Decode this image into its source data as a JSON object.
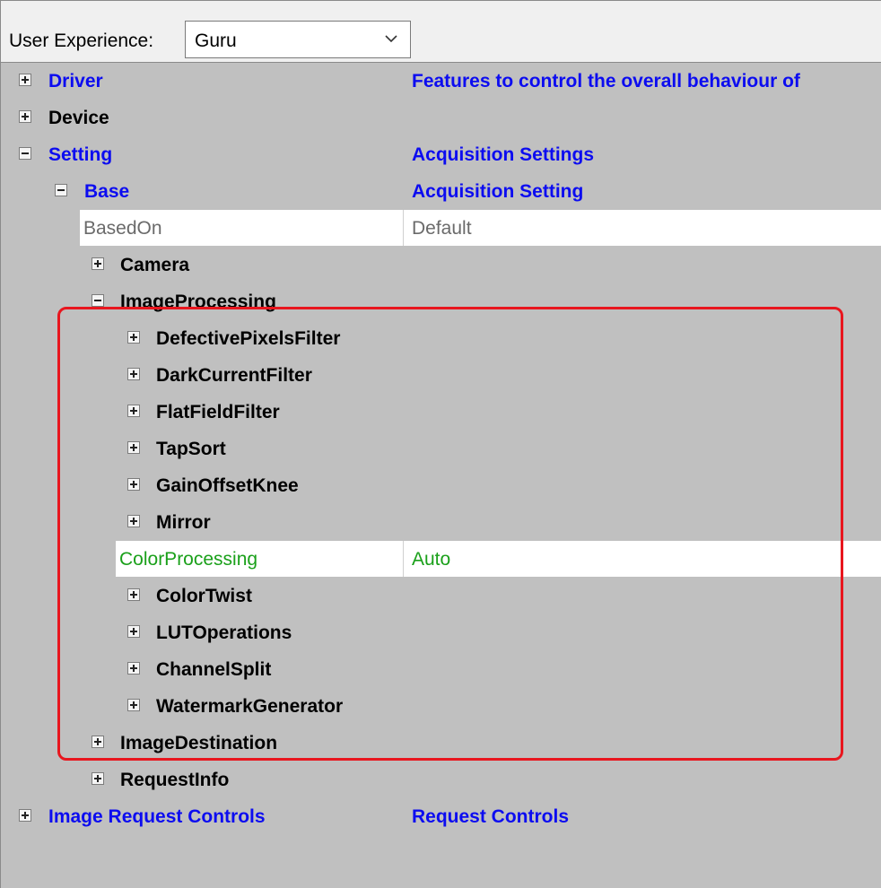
{
  "toolbar": {
    "ux_label": "User Experience:",
    "ux_value": "Guru"
  },
  "tree": {
    "driver": {
      "label": "Driver",
      "desc": "Features to control the overall behaviour of"
    },
    "device": {
      "label": "Device"
    },
    "setting": {
      "label": "Setting",
      "desc": "Acquisition Settings"
    },
    "base": {
      "label": "Base",
      "desc": "Acquisition Setting"
    },
    "based_on": {
      "label": "BasedOn",
      "value": "Default"
    },
    "camera": {
      "label": "Camera"
    },
    "image_processing": {
      "label": "ImageProcessing"
    },
    "defective_pixels_filter": {
      "label": "DefectivePixelsFilter"
    },
    "dark_current_filter": {
      "label": "DarkCurrentFilter"
    },
    "flat_field_filter": {
      "label": "FlatFieldFilter"
    },
    "tap_sort": {
      "label": "TapSort"
    },
    "gain_offset_knee": {
      "label": "GainOffsetKnee"
    },
    "mirror": {
      "label": "Mirror"
    },
    "color_processing": {
      "label": "ColorProcessing",
      "value": "Auto"
    },
    "color_twist": {
      "label": "ColorTwist"
    },
    "lut_operations": {
      "label": "LUTOperations"
    },
    "channel_split": {
      "label": "ChannelSplit"
    },
    "watermark_generator": {
      "label": "WatermarkGenerator"
    },
    "image_destination": {
      "label": "ImageDestination"
    },
    "request_info": {
      "label": "RequestInfo"
    },
    "image_request_controls": {
      "label": "Image Request Controls",
      "desc": "Request Controls"
    }
  },
  "colors": {
    "tree_background": "#c0c0c0",
    "category_blue": "#0c0cf0",
    "changed_green": "#1aa01a",
    "default_gray": "#6a6a6a",
    "highlight_red": "#e8161e"
  }
}
